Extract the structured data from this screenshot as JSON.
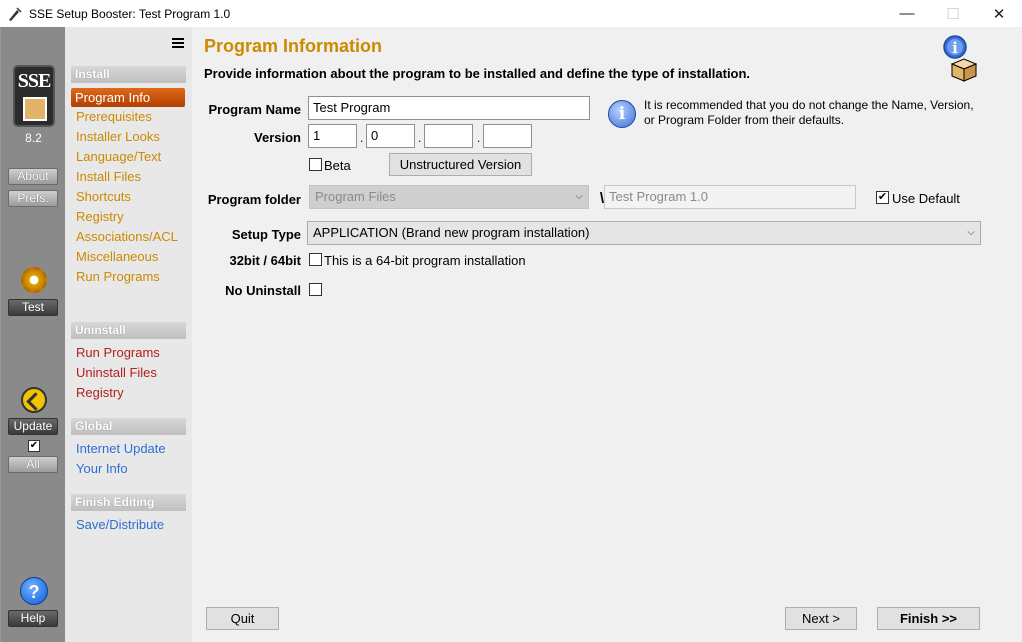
{
  "window": {
    "title": "SSE Setup Booster: Test Program 1.0",
    "minimize": "—",
    "maximize": "☐",
    "close": "✕"
  },
  "leftbar": {
    "logo": "SSE",
    "version": "8.2",
    "about_label": "About",
    "prefs_label": "Prefs.",
    "test_label": "Test",
    "update_label": "Update",
    "update_all_checked": "✔",
    "all_label": "All",
    "help_label": "Help",
    "help_glyph": "?"
  },
  "nav": {
    "install_header": "Install",
    "install_items": [
      "Program Info",
      "Prerequisites",
      "Installer Looks",
      "Language/Text",
      "Install Files",
      "Shortcuts",
      "Registry",
      "Associations/ACL",
      "Miscellaneous",
      "Run Programs"
    ],
    "active_item": "Program Info",
    "uninstall_header": "Uninstall",
    "uninstall_items": [
      "Run Programs",
      "Uninstall Files",
      "Registry"
    ],
    "global_header": "Global",
    "global_items": [
      "Internet Update",
      "Your Info"
    ],
    "finish_header": "Finish Editing",
    "finish_items": [
      "Save/Distribute"
    ]
  },
  "main": {
    "title": "Program Information",
    "description": "Provide information about the program to be installed and define the type of installation.",
    "program_name_label": "Program Name",
    "program_name_value": "Test Program",
    "version_label": "Version",
    "version_parts": [
      "1",
      "0",
      "",
      ""
    ],
    "version_dot": ".",
    "beta_label": "Beta",
    "beta_checked": "",
    "unstructured_version_button": "Unstructured Version",
    "info_glyph": "i",
    "note": "It is recommended that you do not change the Name, Version, or Program Folder from their defaults.",
    "program_folder_label": "Program folder",
    "program_folder_select": "Program Files",
    "program_folder_sep": "\\",
    "program_folder_sub": "Test Program 1.0",
    "use_default_checked": "✔",
    "use_default_label": "Use Default",
    "setup_type_label": "Setup Type",
    "setup_type_value": "APPLICATION  (Brand new program installation)",
    "bitness_label": "32bit / 64bit",
    "bitness_checked": "",
    "bitness_text": "This is a 64-bit program installation",
    "no_uninstall_label": "No Uninstall",
    "no_uninstall_checked": ""
  },
  "footer": {
    "quit": "Quit",
    "next": "Next  >",
    "finish": "Finish  >>"
  },
  "colors": {
    "accent_install": "#cc8a00",
    "accent_uninstall": "#b0201c",
    "accent_global": "#2c6fd1",
    "active_nav": "#c9530a"
  }
}
